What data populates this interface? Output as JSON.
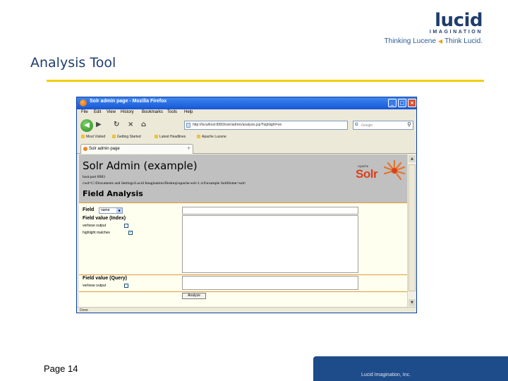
{
  "slide": {
    "logo_word": "lucid",
    "logo_sub": "IMAGINATION",
    "tagline_left": "Thinking Lucene",
    "tagline_right": "Think Lucid.",
    "title": "Analysis Tool",
    "page_number": "Page 14",
    "footer_text": "Lucid Imagination, Inc."
  },
  "browser": {
    "window_title": "Solr admin page - Mozilla Firefox",
    "menu": [
      "File",
      "Edit",
      "View",
      "History",
      "Bookmarks",
      "Tools",
      "Help"
    ],
    "url": "http://localhost:8983/solr/admin/analysis.jsp?highlight=on",
    "search_placeholder": "Google",
    "bookmarks": [
      "Most Visited",
      "Getting Started",
      "Latest Headlines",
      "Apache Lucene"
    ],
    "tab_label": "Solr admin page",
    "tab_add": "+",
    "status": "Done"
  },
  "solr": {
    "title": "Solr Admin (example)",
    "host_line": "host:port 8983",
    "cwd_line": "cwd=C:\\Documents and Settings\\Lucid Imagination\\Desktop\\apache-solr-1.4.0\\example  SolrHome=solr/",
    "section": "Field Analysis",
    "apache": "Apache",
    "solr_word": "Solr",
    "field_label": "Field",
    "field_select": "name",
    "field_value_index": "Field value (Index)",
    "verbose_output": "verbose output",
    "highlight_matches": "highlight matches",
    "field_value_query": "Field value (Query)",
    "verbose_output_query": "verbose output",
    "analyze_button": "Analyze"
  },
  "colors": {
    "brand_navy": "#1f3d6d",
    "accent_yellow": "#f2cf0a",
    "footer_blue": "#1e4c8a",
    "solr_orange": "#d9411e"
  }
}
